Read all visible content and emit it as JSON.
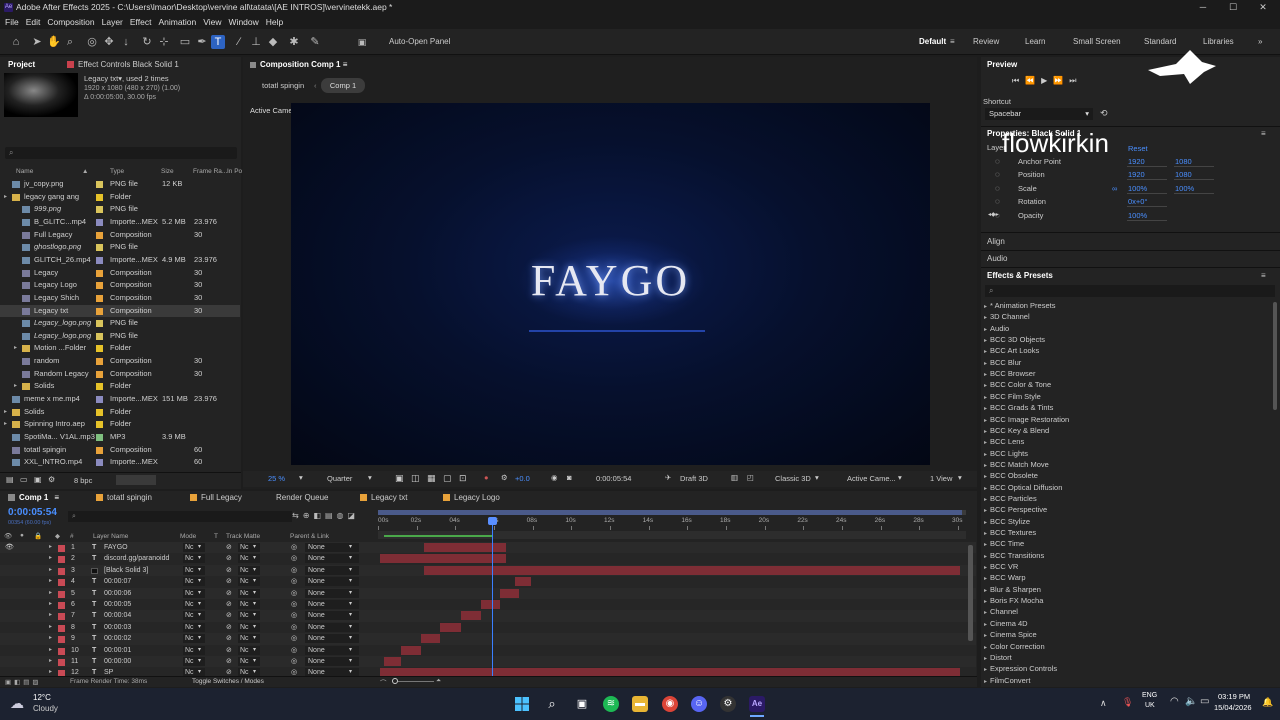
{
  "window": {
    "title": "Adobe After Effects 2025 - C:\\Users\\lmaor\\Desktop\\vervine all\\tatata\\[AE INTROS]\\vervinetekk.aep *",
    "min": "─",
    "max": "☐",
    "close": "✕"
  },
  "menu": [
    "File",
    "Edit",
    "Composition",
    "Layer",
    "Effect",
    "Animation",
    "View",
    "Window",
    "Help"
  ],
  "toolbar": {
    "auto_open_label": "Auto-Open Panel"
  },
  "workspaces": [
    "Default",
    "Review",
    "Learn",
    "Small Screen",
    "Standard",
    "Libraries"
  ],
  "project": {
    "tab": "Project",
    "effect_tab": "Effect Controls Black Solid 1",
    "selected_name": "Legacy txt",
    "used": ", used 2 times",
    "res": "1920 x 1080 (480 x 270) (1.00)",
    "dur": "Δ 0:00:05:00, 30.00 fps",
    "search_placeholder": "",
    "headers": [
      "Name",
      "Type",
      "Size",
      "Frame Ra...",
      "In Po"
    ],
    "items": [
      {
        "name": "jv_copy.png",
        "type": "PNG file",
        "size": "12 KB",
        "fr": "",
        "lc": "#d9c45c",
        "ic": "img",
        "ind": 0
      },
      {
        "name": "legacy gang ang",
        "type": "Folder",
        "size": "",
        "fr": "",
        "lc": "#e6c229",
        "ic": "fold",
        "ind": 0
      },
      {
        "name": "999.png",
        "type": "PNG file",
        "size": "",
        "fr": "",
        "lc": "#d9c45c",
        "ic": "img",
        "ind": 1
      },
      {
        "name": "B_GLITC...mp4",
        "type": "Importe...MEX",
        "size": "5.2 MB",
        "fr": "23.976",
        "lc": "#8b8bbf",
        "ic": "img",
        "ind": 1
      },
      {
        "name": "Full Legacy",
        "type": "Composition",
        "size": "",
        "fr": "30",
        "lc": "#e8a23a",
        "ic": "comp",
        "ind": 1
      },
      {
        "name": "ghostlogo.png",
        "type": "PNG file",
        "size": "",
        "fr": "",
        "lc": "#d9c45c",
        "ic": "img",
        "ind": 1
      },
      {
        "name": "GLITCH_26.mp4",
        "type": "Importe...MEX",
        "size": "4.9 MB",
        "fr": "23.976",
        "lc": "#8b8bbf",
        "ic": "img",
        "ind": 1
      },
      {
        "name": "Legacy",
        "type": "Composition",
        "size": "",
        "fr": "30",
        "lc": "#e8a23a",
        "ic": "comp",
        "ind": 1
      },
      {
        "name": "Legacy Logo",
        "type": "Composition",
        "size": "",
        "fr": "30",
        "lc": "#e8a23a",
        "ic": "comp",
        "ind": 1
      },
      {
        "name": "Legacy Shich",
        "type": "Composition",
        "size": "",
        "fr": "30",
        "lc": "#e8a23a",
        "ic": "comp",
        "ind": 1
      },
      {
        "name": "Legacy txt",
        "type": "Composition",
        "size": "",
        "fr": "30",
        "lc": "#e8a23a",
        "ic": "comp",
        "ind": 1,
        "sel": true
      },
      {
        "name": "Legacy_logo.png",
        "type": "PNG file",
        "size": "",
        "fr": "",
        "lc": "#d9c45c",
        "ic": "img",
        "ind": 1
      },
      {
        "name": "Legacy_logo.png",
        "type": "PNG file",
        "size": "",
        "fr": "",
        "lc": "#d9c45c",
        "ic": "img",
        "ind": 1
      },
      {
        "name": "Motion ...Folder",
        "type": "Folder",
        "size": "",
        "fr": "",
        "lc": "#e6c229",
        "ic": "fold",
        "ind": 1
      },
      {
        "name": "random",
        "type": "Composition",
        "size": "",
        "fr": "30",
        "lc": "#e8a23a",
        "ic": "comp",
        "ind": 1
      },
      {
        "name": "Random Legacy",
        "type": "Composition",
        "size": "",
        "fr": "30",
        "lc": "#e8a23a",
        "ic": "comp",
        "ind": 1
      },
      {
        "name": "Solids",
        "type": "Folder",
        "size": "",
        "fr": "",
        "lc": "#e6c229",
        "ic": "fold",
        "ind": 1
      },
      {
        "name": "meme x me.mp4",
        "type": "Importe...MEX",
        "size": "151 MB",
        "fr": "23.976",
        "lc": "#8b8bbf",
        "ic": "img",
        "ind": 0
      },
      {
        "name": "Solids",
        "type": "Folder",
        "size": "",
        "fr": "",
        "lc": "#e6c229",
        "ic": "fold",
        "ind": 0
      },
      {
        "name": "Spinning Intro.aep",
        "type": "Folder",
        "size": "",
        "fr": "",
        "lc": "#e6c229",
        "ic": "fold",
        "ind": 0
      },
      {
        "name": "SpotiMa... V1AL.mp3",
        "type": "MP3",
        "size": "3.9 MB",
        "fr": "",
        "lc": "#7fbf7f",
        "ic": "img",
        "ind": 0
      },
      {
        "name": "totatl spingin",
        "type": "Composition",
        "size": "",
        "fr": "60",
        "lc": "#e8a23a",
        "ic": "comp",
        "ind": 0
      },
      {
        "name": "XXL_INTRO.mp4",
        "type": "Importe...MEX",
        "size": "",
        "fr": "60",
        "lc": "#8b8bbf",
        "ic": "img",
        "ind": 0
      }
    ],
    "bpc": "8 bpc"
  },
  "comp": {
    "tab": "Composition Comp 1",
    "crumbs": [
      "totatl spingin",
      "Comp 1"
    ],
    "camera": "Active Camera (Default)",
    "text": "FAYGO",
    "zoom": "25 %",
    "res": "Quarter",
    "time": "0:00:05:54",
    "draft": "Draft 3D",
    "renderer": "Classic 3D",
    "cam": "Active Came...",
    "views": "1 View",
    "exposure": "+0.0"
  },
  "preview": {
    "title": "Preview",
    "shortcut_label": "Shortcut",
    "shortcut": "Spacebar"
  },
  "properties": {
    "title": "Properties: Black Solid 1",
    "layer": "Layer",
    "reset": "Reset",
    "watermark": "flowkirkin",
    "rows": [
      {
        "name": "Anchor Point",
        "v1": "1920",
        "v2": "1080"
      },
      {
        "name": "Position",
        "v1": "1920",
        "v2": "1080"
      },
      {
        "name": "Scale",
        "v1": "100%",
        "v2": "100%"
      },
      {
        "name": "Rotation",
        "v1": "0x+0°",
        "v2": ""
      },
      {
        "name": "Opacity",
        "v1": "100%",
        "v2": ""
      }
    ]
  },
  "align": "Align",
  "audio": "Audio",
  "effects": {
    "title": "Effects & Presets",
    "items": [
      "* Animation Presets",
      "3D Channel",
      "Audio",
      "BCC 3D Objects",
      "BCC Art Looks",
      "BCC Blur",
      "BCC Browser",
      "BCC Color & Tone",
      "BCC Film Style",
      "BCC Grads & Tints",
      "BCC Image Restoration",
      "BCC Key & Blend",
      "BCC Lens",
      "BCC Lights",
      "BCC Match Move",
      "BCC Obsolete",
      "BCC Optical Diffusion",
      "BCC Particles",
      "BCC Perspective",
      "BCC Stylize",
      "BCC Textures",
      "BCC Time",
      "BCC Transitions",
      "BCC VR",
      "BCC Warp",
      "Blur & Sharpen",
      "Boris FX Mocha",
      "Channel",
      "Cinema 4D",
      "Cinema Spice",
      "Color Correction",
      "Distort",
      "Expression Controls",
      "FilmConvert"
    ]
  },
  "timeline": {
    "tabs": [
      "Comp 1",
      "totatl spingin",
      "Full Legacy",
      "Render Queue",
      "Legacy txt",
      "Legacy Logo"
    ],
    "timecode": "0:00:05:54",
    "frame": "00354 (60.00 fps)",
    "cols": [
      "#",
      "Layer Name",
      "Mode",
      "T",
      "Track Matte",
      "Parent & Link"
    ],
    "ruler": [
      "00s",
      "02s",
      "04s",
      "06s",
      "08s",
      "10s",
      "12s",
      "14s",
      "16s",
      "18s",
      "20s",
      "22s",
      "24s",
      "26s",
      "28s",
      "30s"
    ],
    "layers": [
      {
        "n": "1",
        "name": "FAYGO",
        "lc": "#c94a55",
        "mode": "Nc",
        "matte": "Nc",
        "parent": "None",
        "s": 2.3,
        "e": 6.5,
        "t": "T"
      },
      {
        "n": "2",
        "name": "discord.gg/paranoidd",
        "lc": "#c94a55",
        "mode": "Nc",
        "matte": "Nc",
        "parent": "None",
        "s": 0,
        "e": 6.5,
        "t": "T"
      },
      {
        "n": "3",
        "name": "[Black Solid 3]",
        "lc": "#c94a55",
        "mode": "Nc",
        "matte": "Nc",
        "parent": "None",
        "s": 2.3,
        "e": 30,
        "t": ""
      },
      {
        "n": "4",
        "name": "00:00:07",
        "lc": "#c94a55",
        "mode": "Nc",
        "matte": "Nc",
        "parent": "None",
        "s": 7,
        "e": 7.8,
        "t": "T"
      },
      {
        "n": "5",
        "name": "00:00:06",
        "lc": "#c94a55",
        "mode": "Nc",
        "matte": "Nc",
        "parent": "None",
        "s": 6.2,
        "e": 7.2,
        "t": "T"
      },
      {
        "n": "6",
        "name": "00:00:05",
        "lc": "#c94a55",
        "mode": "Nc",
        "matte": "Nc",
        "parent": "None",
        "s": 5.2,
        "e": 6.2,
        "t": "T"
      },
      {
        "n": "7",
        "name": "00:00:04",
        "lc": "#c94a55",
        "mode": "Nc",
        "matte": "Nc",
        "parent": "None",
        "s": 4.2,
        "e": 5.2,
        "t": "T"
      },
      {
        "n": "8",
        "name": "00:00:03",
        "lc": "#c94a55",
        "mode": "Nc",
        "matte": "Nc",
        "parent": "None",
        "s": 3.1,
        "e": 4.2,
        "t": "T"
      },
      {
        "n": "9",
        "name": "00:00:02",
        "lc": "#c94a55",
        "mode": "Nc",
        "matte": "Nc",
        "parent": "None",
        "s": 2.1,
        "e": 3.1,
        "t": "T"
      },
      {
        "n": "10",
        "name": "00:00:01",
        "lc": "#c94a55",
        "mode": "Nc",
        "matte": "Nc",
        "parent": "None",
        "s": 1.1,
        "e": 2.1,
        "t": "T"
      },
      {
        "n": "11",
        "name": "00:00:00",
        "lc": "#c94a55",
        "mode": "Nc",
        "matte": "Nc",
        "parent": "None",
        "s": 0.2,
        "e": 1.1,
        "t": "T"
      },
      {
        "n": "12",
        "name": "SP",
        "lc": "#c94a55",
        "mode": "Nc",
        "matte": "Nc",
        "parent": "None",
        "s": 0,
        "e": 30,
        "t": "T"
      }
    ],
    "render_time": "Frame Render Time: 38ms",
    "toggle": "Toggle Switches / Modes"
  },
  "taskbar": {
    "temp": "12°C",
    "weather": "Cloudy",
    "lang1": "ENG",
    "lang2": "UK",
    "time": "03:19 PM",
    "date": "15/04/2026"
  }
}
